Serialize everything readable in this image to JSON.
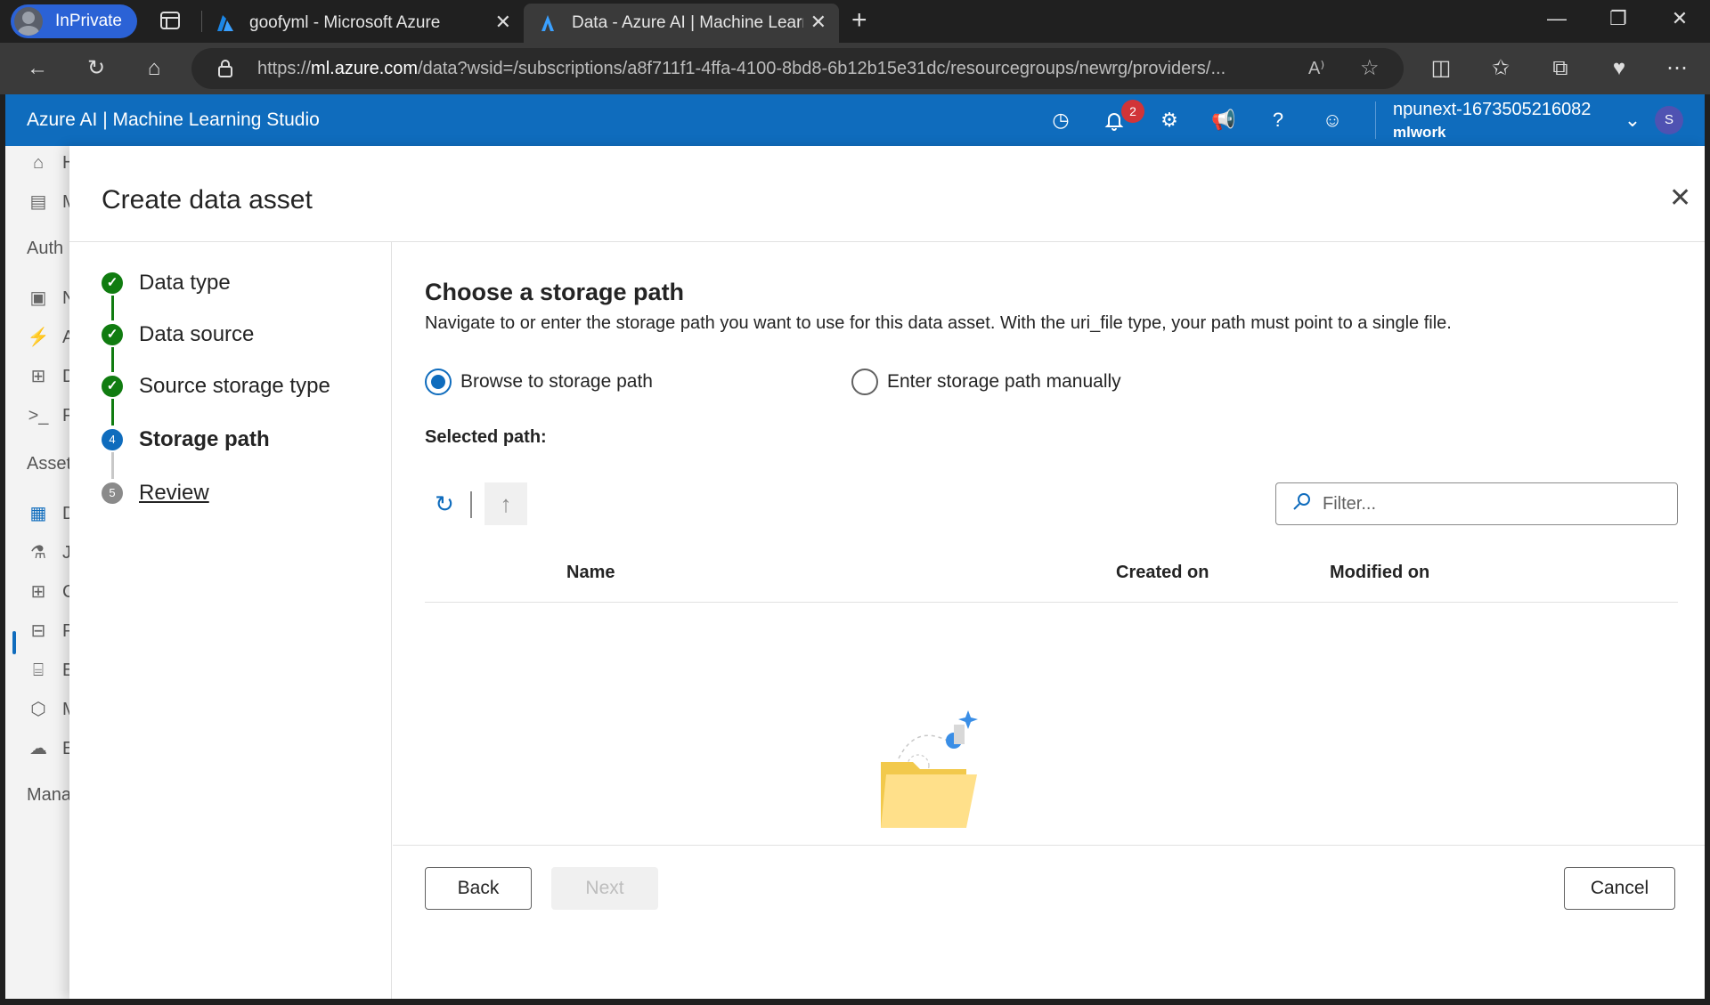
{
  "browser": {
    "inprivate_label": "InPrivate",
    "tabs": [
      {
        "title": "goofyml - Microsoft Azure"
      },
      {
        "title": "Data - Azure AI | Machine Learni"
      }
    ],
    "url_prefix": "https://",
    "url_host": "ml.azure.com",
    "url_rest": "/data?wsid=/subscriptions/a8f711f1-4ffa-4100-8bd8-6b12b15e31dc/resourcegroups/newrg/providers/..."
  },
  "app": {
    "brand": "Azure AI | Machine Learning Studio",
    "notification_count": "2",
    "workspace_name": "npunext-1673505216082",
    "workspace_sub": "mlwork",
    "avatar_initial": "S",
    "accent_color": "#0f6cbd"
  },
  "rail": {
    "items": [
      "H",
      "M",
      "Auth",
      "N",
      "A",
      "D",
      "P",
      "Asset",
      "D",
      "J",
      "C",
      "P",
      "E",
      "M",
      "E",
      "Mana"
    ]
  },
  "panel": {
    "title": "Create data asset",
    "steps": [
      {
        "label": "Data type",
        "state": "done"
      },
      {
        "label": "Data source",
        "state": "done"
      },
      {
        "label": "Source storage type",
        "state": "done"
      },
      {
        "number": "4",
        "label": "Storage path",
        "state": "current"
      },
      {
        "number": "5",
        "label": "Review",
        "state": "todo"
      }
    ],
    "heading": "Choose a storage path",
    "description": "Navigate to or enter the storage path you want to use for this data asset. With the uri_file type, your path must point to a single file.",
    "radio_browse": "Browse to storage path",
    "radio_manual": "Enter storage path manually",
    "selected_path_label": "Selected path:",
    "filter_placeholder": "Filter...",
    "columns": [
      "Name",
      "Created on",
      "Modified on"
    ],
    "footer": {
      "back": "Back",
      "next": "Next",
      "cancel": "Cancel"
    }
  }
}
